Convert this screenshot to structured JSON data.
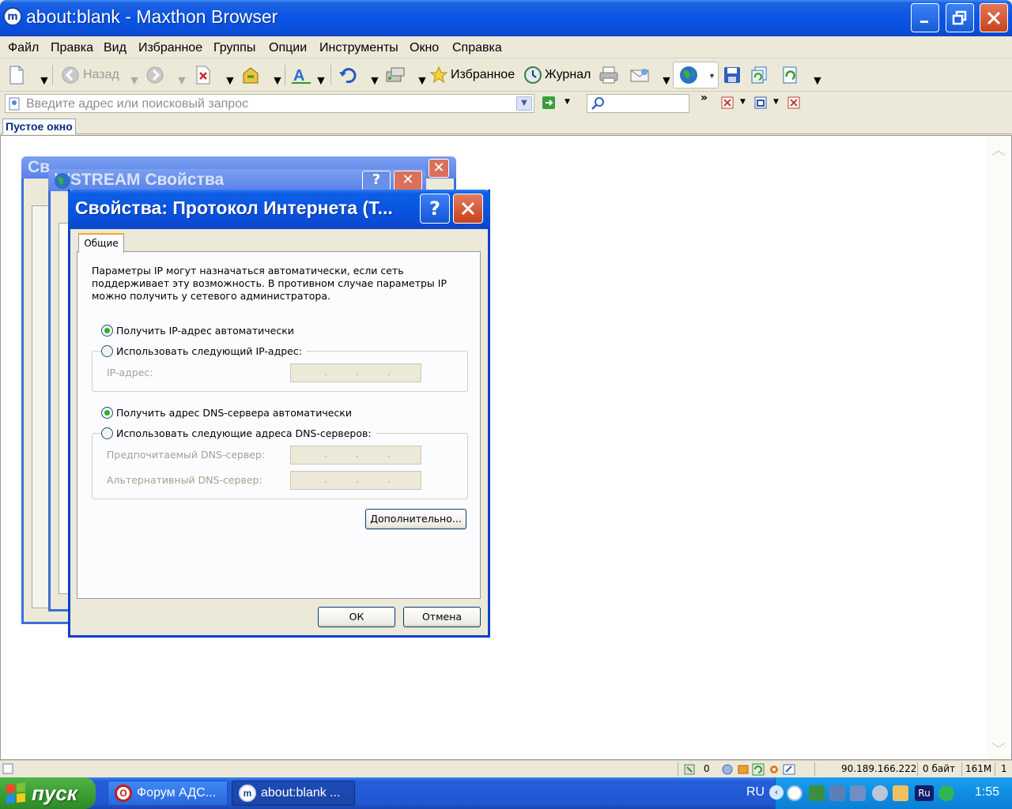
{
  "browser": {
    "title": "about:blank - Maxthon Browser",
    "app_icon": "maxthon-icon",
    "window_buttons": [
      "minimize",
      "restore",
      "close"
    ]
  },
  "menu": [
    "Файл",
    "Правка",
    "Вид",
    "Избранное",
    "Группы",
    "Опции",
    "Инструменты",
    "Окно",
    "Справка"
  ],
  "toolbar": {
    "back_label": "Назад",
    "favorites_label": "Избранное",
    "history_label": "Журнал",
    "more": "»"
  },
  "address": {
    "placeholder": "Введите адрес или поисковый запрос"
  },
  "tabs": [
    {
      "label": "Пустое окно"
    }
  ],
  "background_windows": [
    {
      "title": "Св"
    },
    {
      "title": "WSTREAM Свойства"
    }
  ],
  "dialog": {
    "title": "Свойства: Протокол Интернета (Т...",
    "help": "?",
    "tab": "Общие",
    "description": "Параметры IP могут назначаться автоматически, если сеть поддерживает эту возможность. В противном случае параметры IP можно получить у сетевого администратора.",
    "ip_auto": "Получить IP-адрес автоматически",
    "ip_manual": "Использовать следующий IP-адрес:",
    "ip_label": "IP-адрес:",
    "dns_auto": "Получить адрес DNS-сервера автоматически",
    "dns_manual": "Использовать следующие адреса DNS-серверов:",
    "dns_pref_label": "Предпочитаемый DNS-сервер:",
    "dns_alt_label": "Альтернативный DNS-сервер:",
    "advanced_button": "Дополнительно...",
    "ok_button": "ОК",
    "cancel_button": "Отмена",
    "ip_selected": "auto",
    "dns_selected": "auto"
  },
  "status": {
    "count": "0",
    "ip": "90.189.166.222",
    "bytes": "0 байт",
    "memory": "161M",
    "last": "1"
  },
  "taskbar": {
    "start_label": "пуск",
    "tasks": [
      {
        "label": "Форум АДС...",
        "icon": "opera-icon"
      },
      {
        "label": "about:blank ...",
        "icon": "maxthon-icon"
      }
    ],
    "language": "RU",
    "lang_icon": "Ru",
    "clock": "1:55"
  },
  "colors": {
    "xp_blue": "#0A54E4",
    "start_green": "#3C9F35",
    "tray_blue": "#0F8EE2",
    "close_red": "#C8431C"
  }
}
